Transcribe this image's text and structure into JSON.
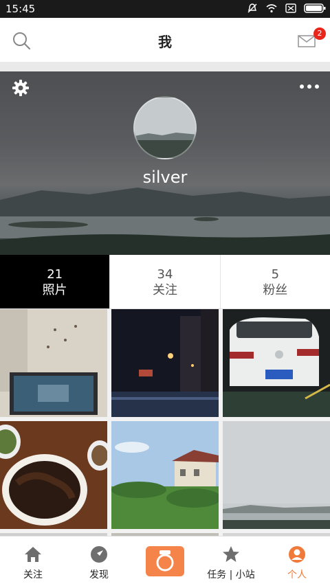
{
  "status_bar": {
    "time": "15:45"
  },
  "header": {
    "title": "我",
    "mail_badge": "2"
  },
  "profile": {
    "username": "silver"
  },
  "stats": [
    {
      "count": "21",
      "label": "照片"
    },
    {
      "count": "34",
      "label": "关注"
    },
    {
      "count": "5",
      "label": "粉丝"
    }
  ],
  "photos": [
    "desk-computer-photo",
    "night-street-photo",
    "white-car-photo",
    "food-plate-photo",
    "house-sky-photo",
    "lake-view-photo"
  ],
  "bottom_nav": [
    {
      "label": "关注",
      "icon": "home-icon"
    },
    {
      "label": "发现",
      "icon": "compass-icon"
    },
    {
      "label": "",
      "icon": "camera-icon"
    },
    {
      "label": "任务 | 小站",
      "icon": "star-icon"
    },
    {
      "label": "个人",
      "icon": "person-icon"
    }
  ],
  "colors": {
    "accent": "#f07a3a",
    "badge": "#e8261b",
    "active_tab_bg": "#000000"
  }
}
